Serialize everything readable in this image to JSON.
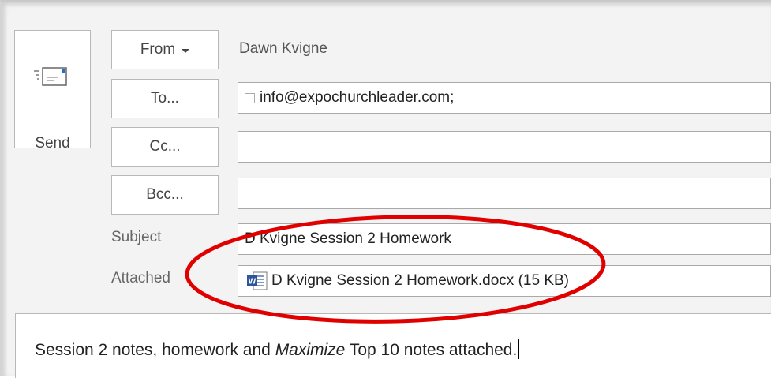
{
  "send": {
    "label": "Send",
    "icon": "send-envelope-icon"
  },
  "from": {
    "label": "From",
    "name": "Dawn Kvigne"
  },
  "to": {
    "label": "To...",
    "recipient": "info@expochurchleader.com",
    "separator": ";"
  },
  "cc": {
    "label": "Cc...",
    "value": ""
  },
  "bcc": {
    "label": "Bcc...",
    "value": ""
  },
  "subject": {
    "label": "Subject",
    "value": "D Kvigne Session 2 Homework"
  },
  "attached": {
    "label": "Attached",
    "file": "D Kvigne Session 2 Homework.docx (15 KB)",
    "icon": "word-document-icon"
  },
  "message": {
    "before": "Session 2 notes, homework and ",
    "emphasis": "Maximize",
    "after": " Top 10 notes attached."
  },
  "colors": {
    "annotation_circle": "#e00000",
    "word_blue": "#2b579a",
    "background": "#f3f3f3"
  }
}
